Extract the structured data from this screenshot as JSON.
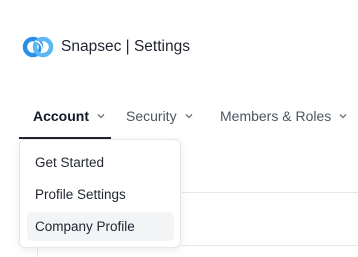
{
  "app": {
    "title": "Snapsec | Settings",
    "logo_icon": "snapsec-logo-icon",
    "brand_color": "#2a8fe6"
  },
  "tabs": [
    {
      "label": "Account",
      "icon": "chevron-down-icon",
      "active": true
    },
    {
      "label": "Security",
      "icon": "chevron-down-icon",
      "active": false
    },
    {
      "label": "Members & Roles",
      "icon": "chevron-down-icon",
      "active": false
    }
  ],
  "account_menu": {
    "open": true,
    "items": [
      {
        "label": "Get Started",
        "selected": false
      },
      {
        "label": "Profile Settings",
        "selected": false
      },
      {
        "label": "Company Profile",
        "selected": true
      }
    ]
  }
}
